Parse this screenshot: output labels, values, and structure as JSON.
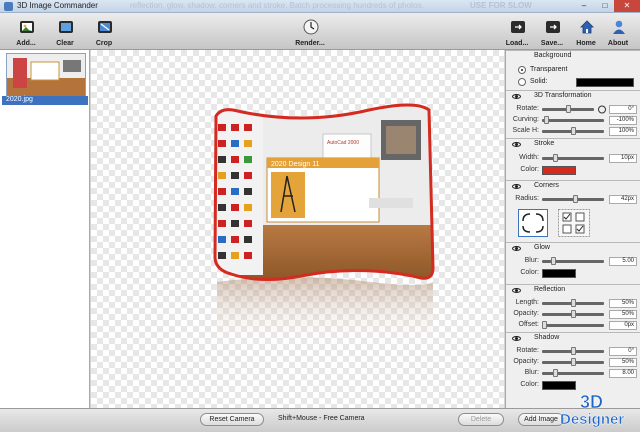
{
  "window": {
    "title": "3D Image Commander",
    "ghost_text": "reflection, glow, shadow, corners and stroke. Batch processing hundreds of photos.",
    "ghost_text2": "USE FOR SLOW",
    "min": "–",
    "max": "□",
    "close": "✕"
  },
  "toolbar": {
    "add": "Add...",
    "clear": "Clear",
    "crop": "Crop",
    "render": "Render...",
    "load": "Load...",
    "save": "Save...",
    "home": "Home",
    "about": "About"
  },
  "thumbnails": [
    {
      "label": "2020.jpg"
    }
  ],
  "preview": {
    "splash_title": "2020 Design 11",
    "autocad_label": "AutoCad 2000"
  },
  "panels": {
    "background": {
      "title": "Background",
      "transparent_label": "Transparent",
      "solid_label": "Solid:",
      "selected": "Transparent",
      "solid_color": "#000000"
    },
    "transform": {
      "title": "3D Transformation",
      "rotate_label": "Rotate:",
      "rotate_value": "0°",
      "rotate_level": 0.5,
      "curving_label": "Curving:",
      "curving_value": "-100%",
      "curving_level": 0.03,
      "scale_label": "Scale H:",
      "scale_value": "100%",
      "scale_level": 0.5
    },
    "stroke": {
      "title": "Stroke",
      "width_label": "Width:",
      "width_value": "10px",
      "width_level": 0.2,
      "color_label": "Color:",
      "color": "#d42a20"
    },
    "corners": {
      "title": "Corners",
      "radius_label": "Radius:",
      "radius_value": "42px",
      "radius_level": 0.55
    },
    "glow": {
      "title": "Glow",
      "blur_label": "Blur:",
      "blur_value": "5.00",
      "blur_level": 0.15,
      "color_label": "Color:",
      "color": "#000000"
    },
    "reflection": {
      "title": "Reflection",
      "length_label": "Length:",
      "length_value": "50%",
      "length_level": 0.5,
      "opacity_label": "Opacity:",
      "opacity_value": "50%",
      "opacity_level": 0.5,
      "offset_label": "Offset:",
      "offset_value": "0px",
      "offset_level": 0.0
    },
    "shadow": {
      "title": "Shadow",
      "rotate_label": "Rotate:",
      "rotate_value": "0°",
      "rotate_level": 0.5,
      "opacity_label": "Opacity:",
      "opacity_value": "50%",
      "opacity_level": 0.5,
      "blur_label": "Blur:",
      "blur_value": "8.00",
      "blur_level": 0.2,
      "color_label": "Color:",
      "color": "#000000"
    }
  },
  "bottom": {
    "reset_camera": "Reset Camera",
    "hint": "Shift+Mouse - Free Camera",
    "delete": "Delete",
    "add_image": "Add Image"
  },
  "watermark": {
    "line1": "3D",
    "line2": "Designer"
  }
}
